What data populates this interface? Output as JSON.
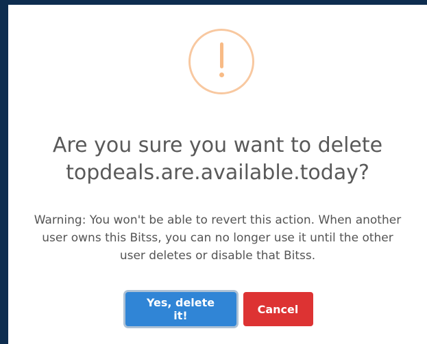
{
  "dialog": {
    "icon": "exclamation-warning-icon",
    "title": "Are you sure you want to delete topdeals.are.available.today?",
    "message": "Warning: You won't be able to revert this action. When another user owns this Bitss, you can no longer use it until the other user deletes or disable that Bitss.",
    "confirm_label": "Yes, delete it!",
    "cancel_label": "Cancel"
  },
  "colors": {
    "background": "#0e2d4f",
    "warning": "#f8bb86",
    "confirm": "#3085d6",
    "cancel": "#dd3333"
  }
}
